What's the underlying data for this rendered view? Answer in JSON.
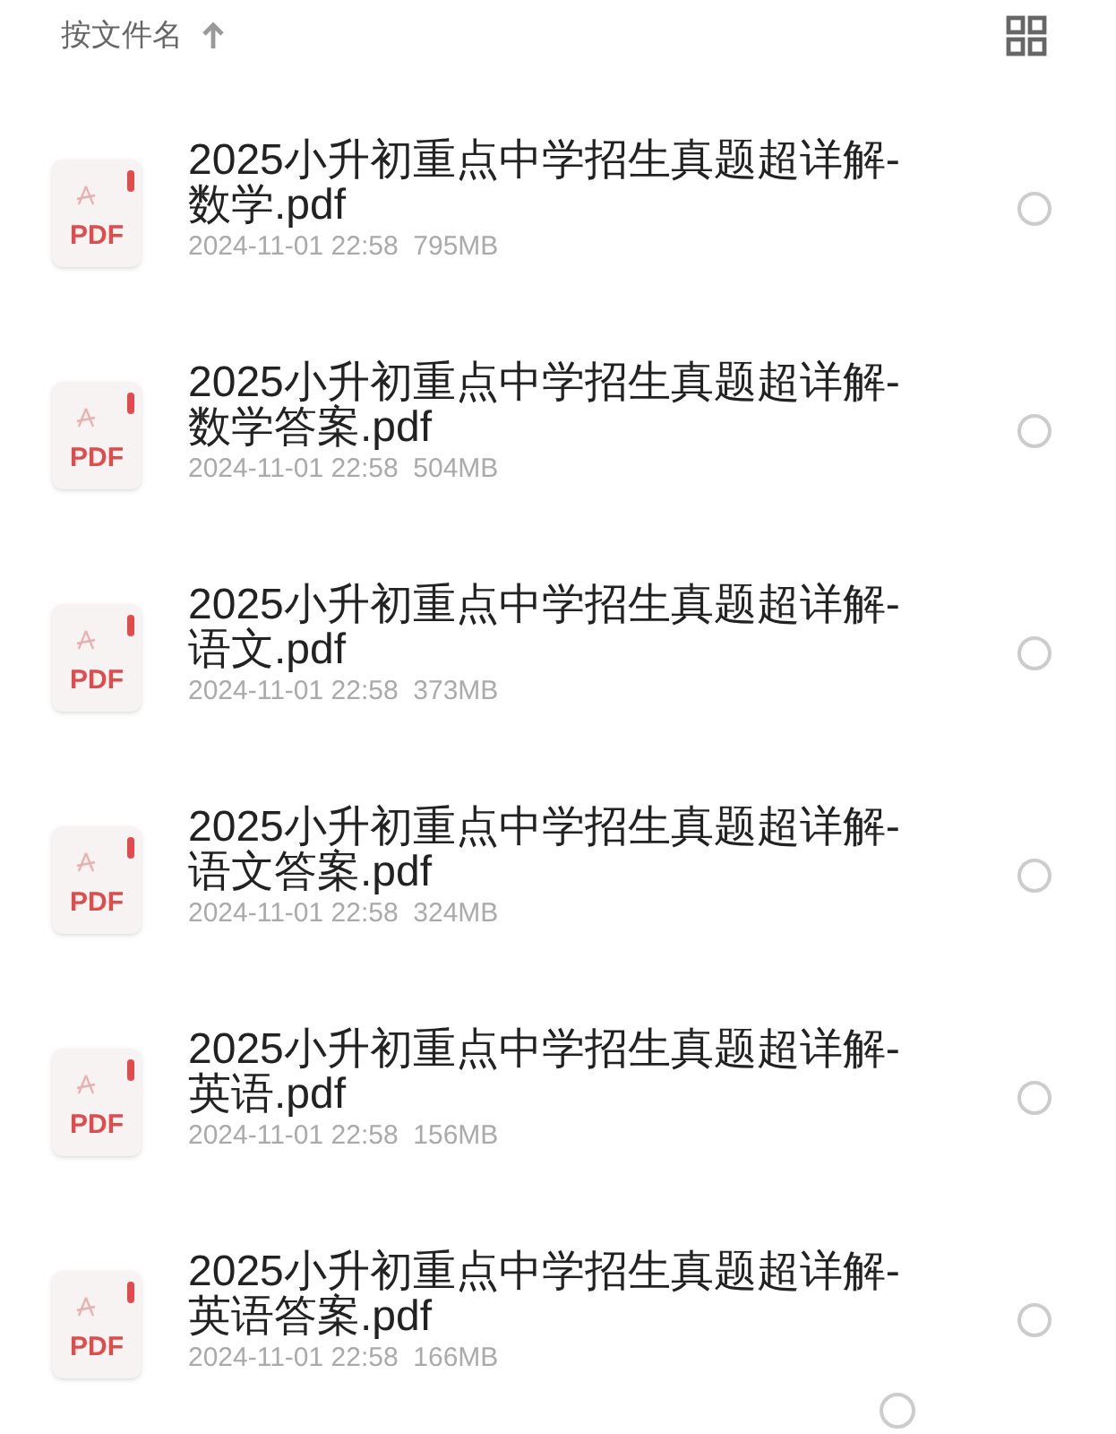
{
  "sort_bar": {
    "label": "按文件名",
    "ascending": true
  },
  "files": [
    {
      "name": "2025小升初重点中学招生真题超详解-数学.pdf",
      "type": "PDF",
      "date": "2024-11-01 22:58",
      "size": "795MB",
      "selected": false
    },
    {
      "name": "2025小升初重点中学招生真题超详解-数学答案.pdf",
      "type": "PDF",
      "date": "2024-11-01 22:58",
      "size": "504MB",
      "selected": false
    },
    {
      "name": "2025小升初重点中学招生真题超详解-语文.pdf",
      "type": "PDF",
      "date": "2024-11-01 22:58",
      "size": "373MB",
      "selected": false
    },
    {
      "name": "2025小升初重点中学招生真题超详解-语文答案.pdf",
      "type": "PDF",
      "date": "2024-11-01 22:58",
      "size": "324MB",
      "selected": false
    },
    {
      "name": "2025小升初重点中学招生真题超详解-英语.pdf",
      "type": "PDF",
      "date": "2024-11-01 22:58",
      "size": "156MB",
      "selected": false
    },
    {
      "name": "2025小升初重点中学招生真题超详解-英语答案.pdf",
      "type": "PDF",
      "date": "2024-11-01 22:58",
      "size": "166MB",
      "selected": false
    }
  ]
}
